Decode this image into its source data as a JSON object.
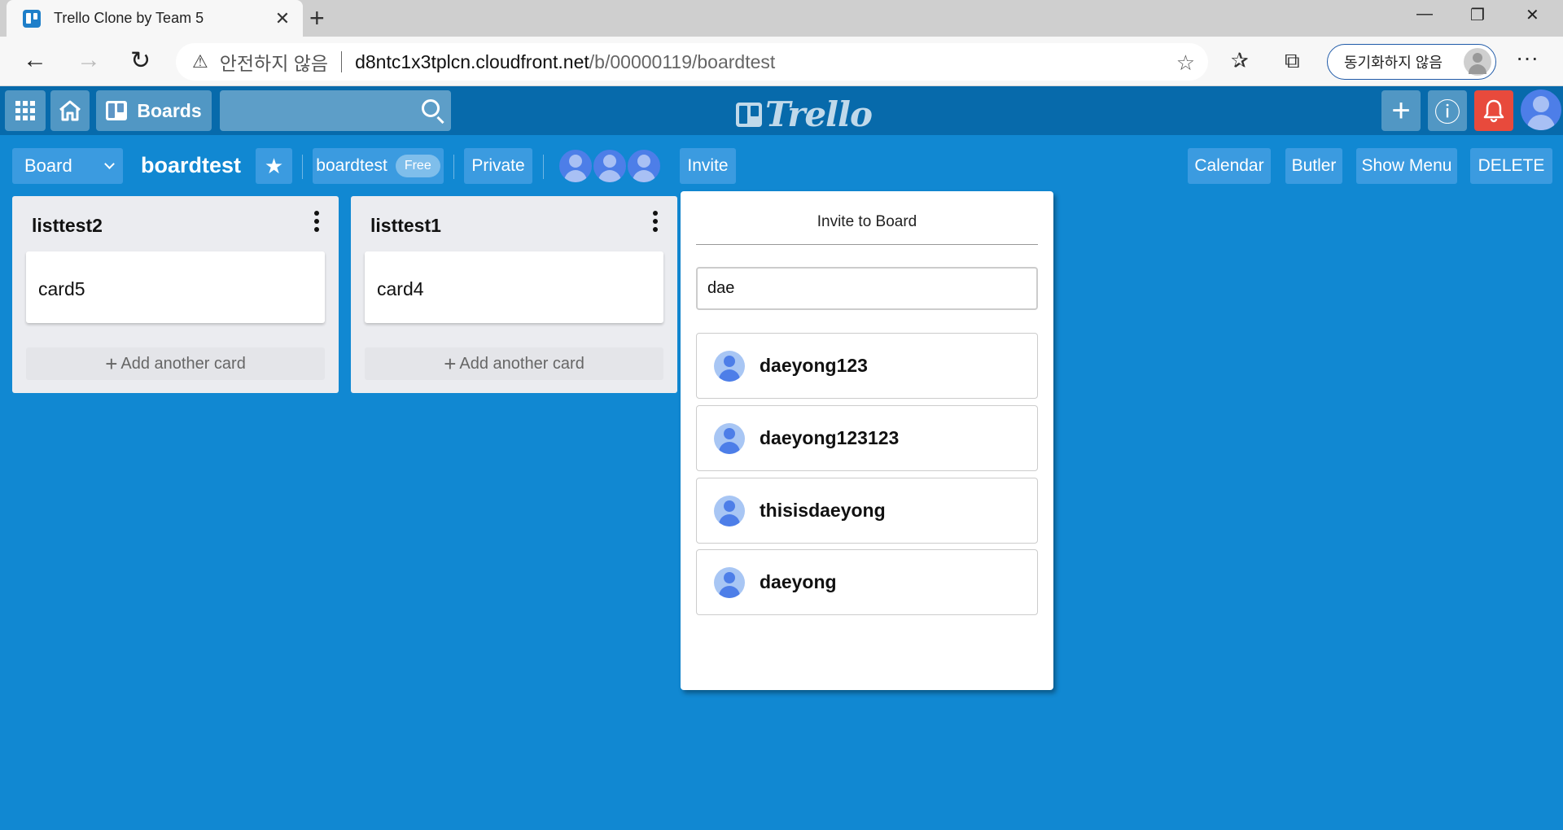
{
  "browser": {
    "tab_title": "Trello Clone by Team 5",
    "tab_close": "✕",
    "new_tab": "+",
    "window_min": "—",
    "window_restore": "❐",
    "window_close": "✕",
    "back": "←",
    "forward": "→",
    "reload": "↻",
    "security_warning": "안전하지 않음",
    "url_host": "d8ntc1x3tplcn.cloudfront.net",
    "url_path": "/b/00000119/boardtest",
    "favorite_star": "☆",
    "favorites_icon": "✰",
    "collections_icon": "⧉",
    "sync_label": "동기화하지 않음",
    "more": "···"
  },
  "appbar": {
    "boards_label": "Boards",
    "logo_text": "Trello",
    "add_label": "+",
    "info_label": "ⓘ",
    "notif_label": "🔔"
  },
  "board": {
    "view_select": "Board",
    "title": "boardtest",
    "star": "★",
    "workspace": "boardtest",
    "plan_badge": "Free",
    "visibility": "Private",
    "invite_label": "Invite",
    "calendar_label": "Calendar",
    "butler_label": "Butler",
    "show_menu_label": "Show Menu",
    "delete_label": "DELETE"
  },
  "lists": [
    {
      "title": "listtest2",
      "cards": [
        "card5"
      ],
      "add_card_label": "Add another card"
    },
    {
      "title": "listtest1",
      "cards": [
        "card4"
      ],
      "add_card_label": "Add another card"
    }
  ],
  "invite_popup": {
    "title": "Invite to Board",
    "search_value": "dae",
    "results": [
      "daeyong123",
      "daeyong123123",
      "thisisdaeyong",
      "daeyong"
    ]
  },
  "colors": {
    "board_bg": "#1188d2",
    "header_bg": "#076aab",
    "notification": "#e84a3c",
    "avatar": "#4d7ee8"
  },
  "icons": {
    "apps": "grid-icon",
    "home": "home-icon",
    "search": "search-icon",
    "list_menu": "kebab-icon",
    "member": "user-icon"
  }
}
